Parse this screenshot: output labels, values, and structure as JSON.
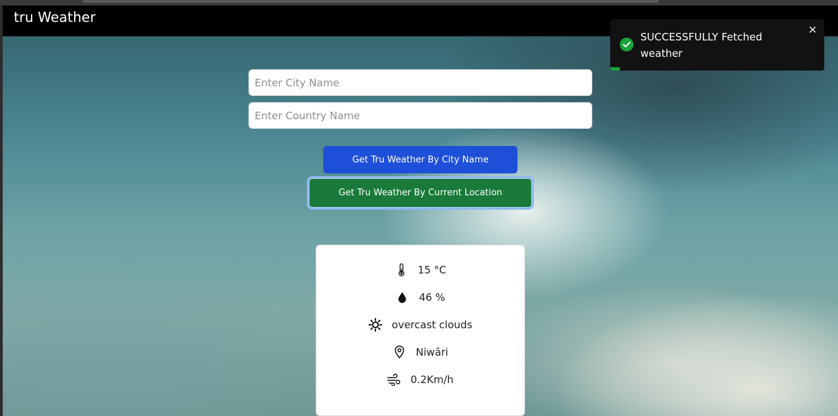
{
  "app": {
    "title": "tru Weather"
  },
  "form": {
    "city_placeholder": "Enter City Name",
    "country_placeholder": "Enter Country Name",
    "city_button": "Get Tru Weather By City Name",
    "location_button": "Get Tru Weather By Current Location"
  },
  "weather": {
    "temperature": "15 °C",
    "humidity": "46 %",
    "condition": "overcast clouds",
    "location": "Niwāri",
    "wind": "0.2Km/h"
  },
  "toast": {
    "message": "SUCCESSFULLY Fetched weather",
    "progress": 0.045,
    "color": "#1aa33a"
  },
  "colors": {
    "primary_button": "#1e4fd8",
    "success_button": "#197a3b",
    "navbar": "#000000"
  },
  "icons": {
    "temperature": "thermometer-icon",
    "humidity": "droplet-icon",
    "condition": "sun-icon",
    "location": "map-pin-icon",
    "wind": "wind-icon",
    "toast_status": "check-circle-icon",
    "toast_close": "close-icon"
  }
}
